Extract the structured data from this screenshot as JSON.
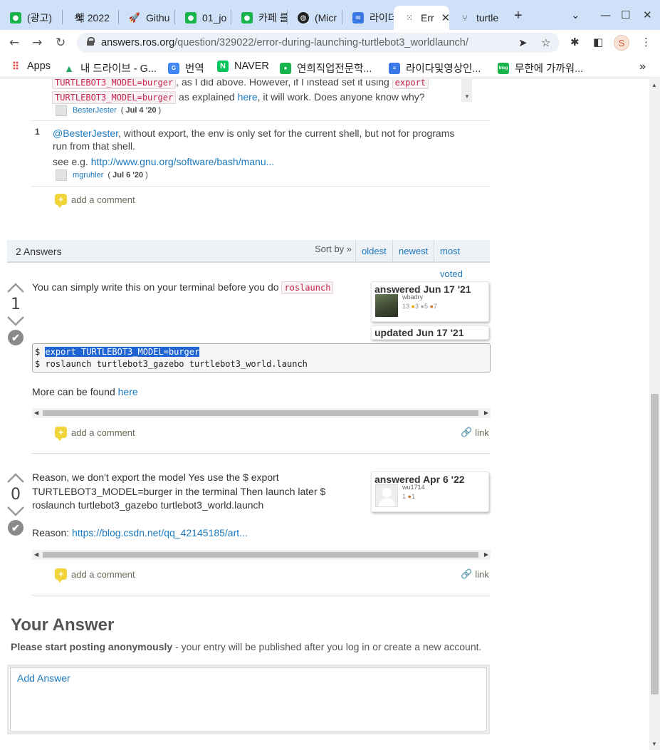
{
  "browser": {
    "tabs": [
      {
        "label": "(광고)",
        "fav_color": "#19b44c"
      },
      {
        "label": "책 2022",
        "fav_color": "#ffffff"
      },
      {
        "label": "Githu",
        "fav_color": "#ffffff"
      },
      {
        "label": "01_jo",
        "fav_color": "#19b44c"
      },
      {
        "label": "카페 를",
        "fav_color": "#19b44c"
      },
      {
        "label": "(Micr",
        "fav_color": "#222222"
      },
      {
        "label": "라이더",
        "fav_color": "#3b78e7"
      },
      {
        "label": "Err",
        "fav_color": "#444444"
      },
      {
        "label": "turtle",
        "fav_color": "#ffffff"
      }
    ],
    "new_tab": "+",
    "url_host": "answers.ros.org",
    "url_path": "/question/329022/error-during-launching-turtlebot3_worldlaunch/",
    "profile_initial": "S",
    "bookmarks": [
      {
        "label": "Apps"
      },
      {
        "label": "내 드라이브 - G..."
      },
      {
        "label": "번역"
      },
      {
        "label": "NAVER"
      },
      {
        "label": "연희직업전문학..."
      },
      {
        "label": "라이다및영상인..."
      },
      {
        "label": "무한에 가까워..."
      }
    ],
    "bookmarks_more": "»"
  },
  "comments": {
    "c0": {
      "code1": "TURTLEBOT3_MODEL=burger",
      "text1": ", as I did above. However, if I instead set it using",
      "code2": "export",
      "code3": "TURTLEBOT3_MODEL=burger",
      "text2": " as explained ",
      "link": "here",
      "text3": ", it will work. Does anyone know why?",
      "user": "BesterJester",
      "date": "Jul 4 '20"
    },
    "c1": {
      "score": "1",
      "mention": "@BesterJester",
      "text": ", without export, the env is only set for the current shell, but not for programs run from that shell.",
      "see": "see e.g. ",
      "link": "http://www.gnu.org/software/bash/manu...",
      "user": "mgruhler",
      "date": "Jul 6 '20"
    },
    "add_comment": "add a comment"
  },
  "answers_header": {
    "count": "2 Answers",
    "sort_by": "Sort by »",
    "sorts": [
      "oldest",
      "newest",
      "most voted"
    ]
  },
  "answer1": {
    "votes": "1",
    "text": "You can simply write this on your terminal before you do ",
    "inline_code": "roslaunch",
    "answered": "answered Jun 17 '21",
    "user": "wbadry",
    "rep": "13",
    "gold": "3",
    "silver": "5",
    "bronze": "7",
    "updated": "updated Jun 17 '21",
    "code_line1_prompt": "$ ",
    "code_line1_sel": "export TURTLEBOT3_MODEL=burger",
    "code_line2": "$ roslaunch turtlebot3_gazebo turtlebot3_world.launch",
    "more_text": "More can be found ",
    "more_link": "here",
    "add_comment": "add a comment",
    "permalink": "link"
  },
  "answer2": {
    "votes": "0",
    "text": "Reason, we don't export the model Yes use the $ export TURTLEBOT3_MODEL=burger in the terminal Then launch later $ roslaunch turtlebot3_gazebo turtlebot3_world.launch",
    "reason_label": "Reason: ",
    "reason_link": "https://blog.csdn.net/qq_42145185/art...",
    "answered": "answered Apr 6 '22",
    "user": "wu1714",
    "rep": "1",
    "bronze": "1",
    "add_comment": "add a comment",
    "permalink": "link"
  },
  "your_answer": {
    "heading": "Your Answer",
    "note_bold": "Please start posting anonymously",
    "note_rest": " - your entry will be published after you log in or create a new account.",
    "placeholder": "Add Answer"
  },
  "colors": {
    "link": "#1b79bd",
    "tabstrip": "#cfe1f8",
    "selection": "#1e64d2",
    "comment_bubble": "#f0d43a"
  }
}
